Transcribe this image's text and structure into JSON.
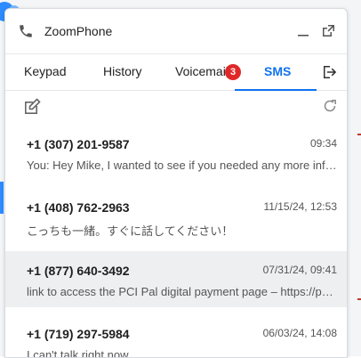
{
  "window": {
    "title": "ZoomPhone"
  },
  "tabs": [
    {
      "label": "Keypad"
    },
    {
      "label": "History"
    },
    {
      "label": "Voicemail",
      "badge": "3"
    },
    {
      "label": "SMS",
      "active": true
    }
  ],
  "conversations": [
    {
      "number": "+1 (307) 201-9587",
      "time": "09:34",
      "preview": "You: Hey Mike, I wanted to see if you needed any more info or had questions"
    },
    {
      "number": "+1 (408) 762-2963",
      "time": "11/15/24, 12:53",
      "preview": "こっちも一緒。すぐに話してください！"
    },
    {
      "number": "+1 (877) 640-3492",
      "time": "07/31/24, 09:41",
      "preview": "link to access the PCI Pal digital payment page – https://pcipal.example",
      "selected": true
    },
    {
      "number": "+1 (719) 297-5984",
      "time": "06/03/24, 14:08",
      "preview": "I can't talk right now."
    }
  ],
  "colors": {
    "accent": "#0e72ed",
    "badge": "#e02828",
    "selected_row": "#eeeff1"
  },
  "icons": {
    "phone": "phone-icon",
    "minimize": "minimize-icon",
    "popout": "popout-icon",
    "logout": "logout-icon",
    "compose": "compose-icon",
    "refresh": "refresh-icon"
  }
}
